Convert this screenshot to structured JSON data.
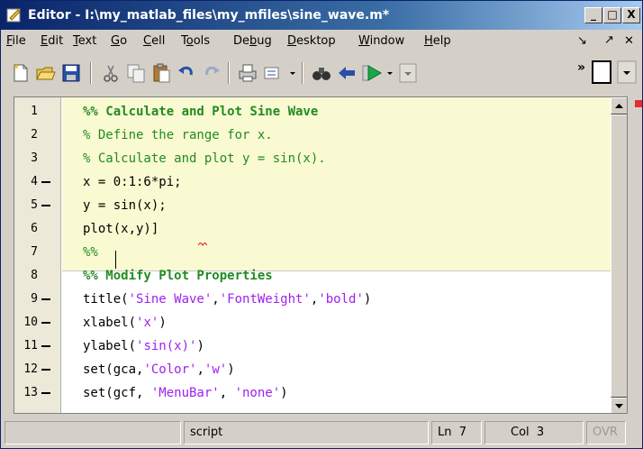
{
  "window": {
    "title": "Editor - I:\\my_matlab_files\\my_mfiles\\sine_wave.m*",
    "min_label": "_",
    "max_label": "□",
    "close_label": "X"
  },
  "menu": {
    "items": [
      {
        "accel": "F",
        "rest": "ile"
      },
      {
        "accel": "E",
        "rest": "dit"
      },
      {
        "accel": "T",
        "rest": "ext"
      },
      {
        "accel": "G",
        "rest": "o"
      },
      {
        "accel": "C",
        "rest": "ell"
      },
      {
        "pre": "T",
        "accel": "o",
        "rest": "ols"
      },
      {
        "pre": "De",
        "accel": "b",
        "rest": "ug"
      },
      {
        "accel": "D",
        "rest": "esktop"
      },
      {
        "accel": "W",
        "rest": "indow"
      },
      {
        "accel": "H",
        "rest": "elp"
      }
    ],
    "dock_glyph": "↘",
    "undock_glyph": "↗",
    "close_glyph": "✕"
  },
  "toolbar": {
    "icons": [
      "new-file-icon",
      "open-folder-icon",
      "save-icon",
      "cut-icon",
      "copy-icon",
      "paste-icon",
      "undo-icon",
      "redo-icon",
      "print-icon",
      "go-to-icon",
      "find-icon",
      "back-icon",
      "run-icon",
      "dropdown-icon",
      "more-icon",
      "stack-icon"
    ],
    "overflow": "»"
  },
  "editor": {
    "lines": [
      {
        "num": "1",
        "bp": false,
        "segs": [
          {
            "t": "%% Calculate and Plot Sine Wave",
            "c": "cellhead"
          }
        ]
      },
      {
        "num": "2",
        "bp": false,
        "segs": [
          {
            "t": "% Define the range for x.",
            "c": "comment"
          }
        ]
      },
      {
        "num": "3",
        "bp": false,
        "segs": [
          {
            "t": "% Calculate and plot y = sin(x).",
            "c": "comment"
          }
        ]
      },
      {
        "num": "4",
        "bp": true,
        "segs": [
          {
            "t": "x = 0:1:6*pi;",
            "c": ""
          }
        ]
      },
      {
        "num": "5",
        "bp": true,
        "segs": [
          {
            "t": "y = sin(x);",
            "c": ""
          }
        ]
      },
      {
        "num": "6",
        "bp": false,
        "segs": [
          {
            "t": "plot(x,y)]",
            "c": ""
          }
        ]
      },
      {
        "num": "7",
        "bp": false,
        "segs": [
          {
            "t": "%%",
            "c": "comment"
          }
        ]
      },
      {
        "num": "8",
        "bp": false,
        "segs": [
          {
            "t": "%% Modify Plot Properties",
            "c": "cellhead"
          }
        ]
      },
      {
        "num": "9",
        "bp": true,
        "segs": [
          {
            "t": "title(",
            "c": ""
          },
          {
            "t": "'Sine Wave'",
            "c": "str"
          },
          {
            "t": ",",
            "c": ""
          },
          {
            "t": "'FontWeight'",
            "c": "str"
          },
          {
            "t": ",",
            "c": ""
          },
          {
            "t": "'bold'",
            "c": "str"
          },
          {
            "t": ")",
            "c": ""
          }
        ]
      },
      {
        "num": "10",
        "bp": true,
        "segs": [
          {
            "t": "xlabel(",
            "c": ""
          },
          {
            "t": "'x'",
            "c": "str"
          },
          {
            "t": ")",
            "c": ""
          }
        ]
      },
      {
        "num": "11",
        "bp": true,
        "segs": [
          {
            "t": "ylabel(",
            "c": ""
          },
          {
            "t": "'sin(x)'",
            "c": "str"
          },
          {
            "t": ")",
            "c": ""
          }
        ]
      },
      {
        "num": "12",
        "bp": true,
        "segs": [
          {
            "t": "set(gca,",
            "c": ""
          },
          {
            "t": "'Color'",
            "c": "str"
          },
          {
            "t": ",",
            "c": ""
          },
          {
            "t": "'w'",
            "c": "str"
          },
          {
            "t": ")",
            "c": ""
          }
        ]
      },
      {
        "num": "13",
        "bp": true,
        "segs": [
          {
            "t": "set(gcf, ",
            "c": ""
          },
          {
            "t": "'MenuBar'",
            "c": "str"
          },
          {
            "t": ", ",
            "c": ""
          },
          {
            "t": "'none'",
            "c": "str"
          },
          {
            "t": ")",
            "c": ""
          }
        ]
      }
    ]
  },
  "status": {
    "mode": "script",
    "ln_label": "Ln",
    "ln_value": "7",
    "col_label": "Col",
    "col_value": "3",
    "ovr": "OVR"
  },
  "colors": {
    "cell_highlight": "#fafad2",
    "comment": "#228b22",
    "string": "#a020f0",
    "titlebar": "#0a246a"
  }
}
